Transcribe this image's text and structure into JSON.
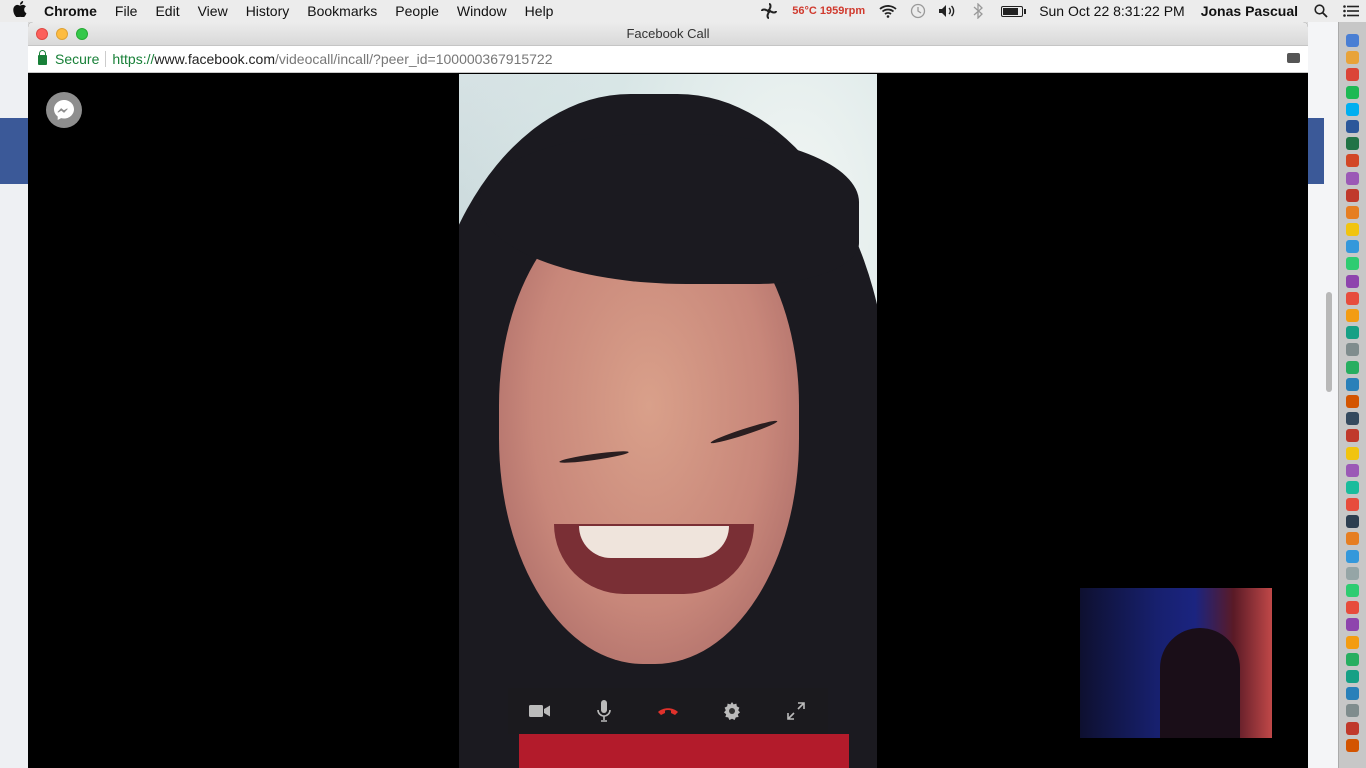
{
  "menubar": {
    "app_name": "Chrome",
    "menus": [
      "File",
      "Edit",
      "View",
      "History",
      "Bookmarks",
      "People",
      "Window",
      "Help"
    ],
    "temperature": "56°C 1959rpm",
    "clock": "Sun Oct 22  8:31:22 PM",
    "user": "Jonas Pascual",
    "battery_level": 0.9,
    "icons": [
      "apple-icon",
      "fan-icon",
      "wifi-icon",
      "time-machine-icon",
      "volume-icon",
      "bluetooth-icon",
      "battery-icon",
      "search-icon",
      "notifications-icon"
    ]
  },
  "window": {
    "title": "Facebook Call",
    "url": {
      "secure_label": "Secure",
      "scheme": "https://",
      "domain": "www.facebook.com",
      "path": "/videocall/incall/?peer_id=100000367915722"
    }
  },
  "call": {
    "controls": [
      "camera-icon",
      "microphone-icon",
      "end-call-icon",
      "settings-icon",
      "fullscreen-icon"
    ],
    "end_call_color": "#e0312b"
  },
  "dock": {
    "colors": [
      "#4a7fd4",
      "#e8a33a",
      "#db4437",
      "#1db954",
      "#00aff0",
      "#2b579a",
      "#217346",
      "#d24726",
      "#9b59b6",
      "#c0392b",
      "#e67e22",
      "#f1c40f",
      "#3498db",
      "#2ecc71",
      "#8e44ad",
      "#e74c3c",
      "#f39c12",
      "#16a085",
      "#7f8c8d",
      "#27ae60",
      "#2980b9",
      "#d35400",
      "#34495e",
      "#c0392b",
      "#f1c40f",
      "#9b59b6",
      "#1abc9c",
      "#e74c3c",
      "#2c3e50",
      "#e67e22",
      "#3498db",
      "#95a5a6",
      "#2ecc71",
      "#e74c3c",
      "#8e44ad",
      "#f39c12",
      "#27ae60",
      "#16a085",
      "#2980b9",
      "#7f8c8d",
      "#c0392b",
      "#d35400"
    ]
  }
}
